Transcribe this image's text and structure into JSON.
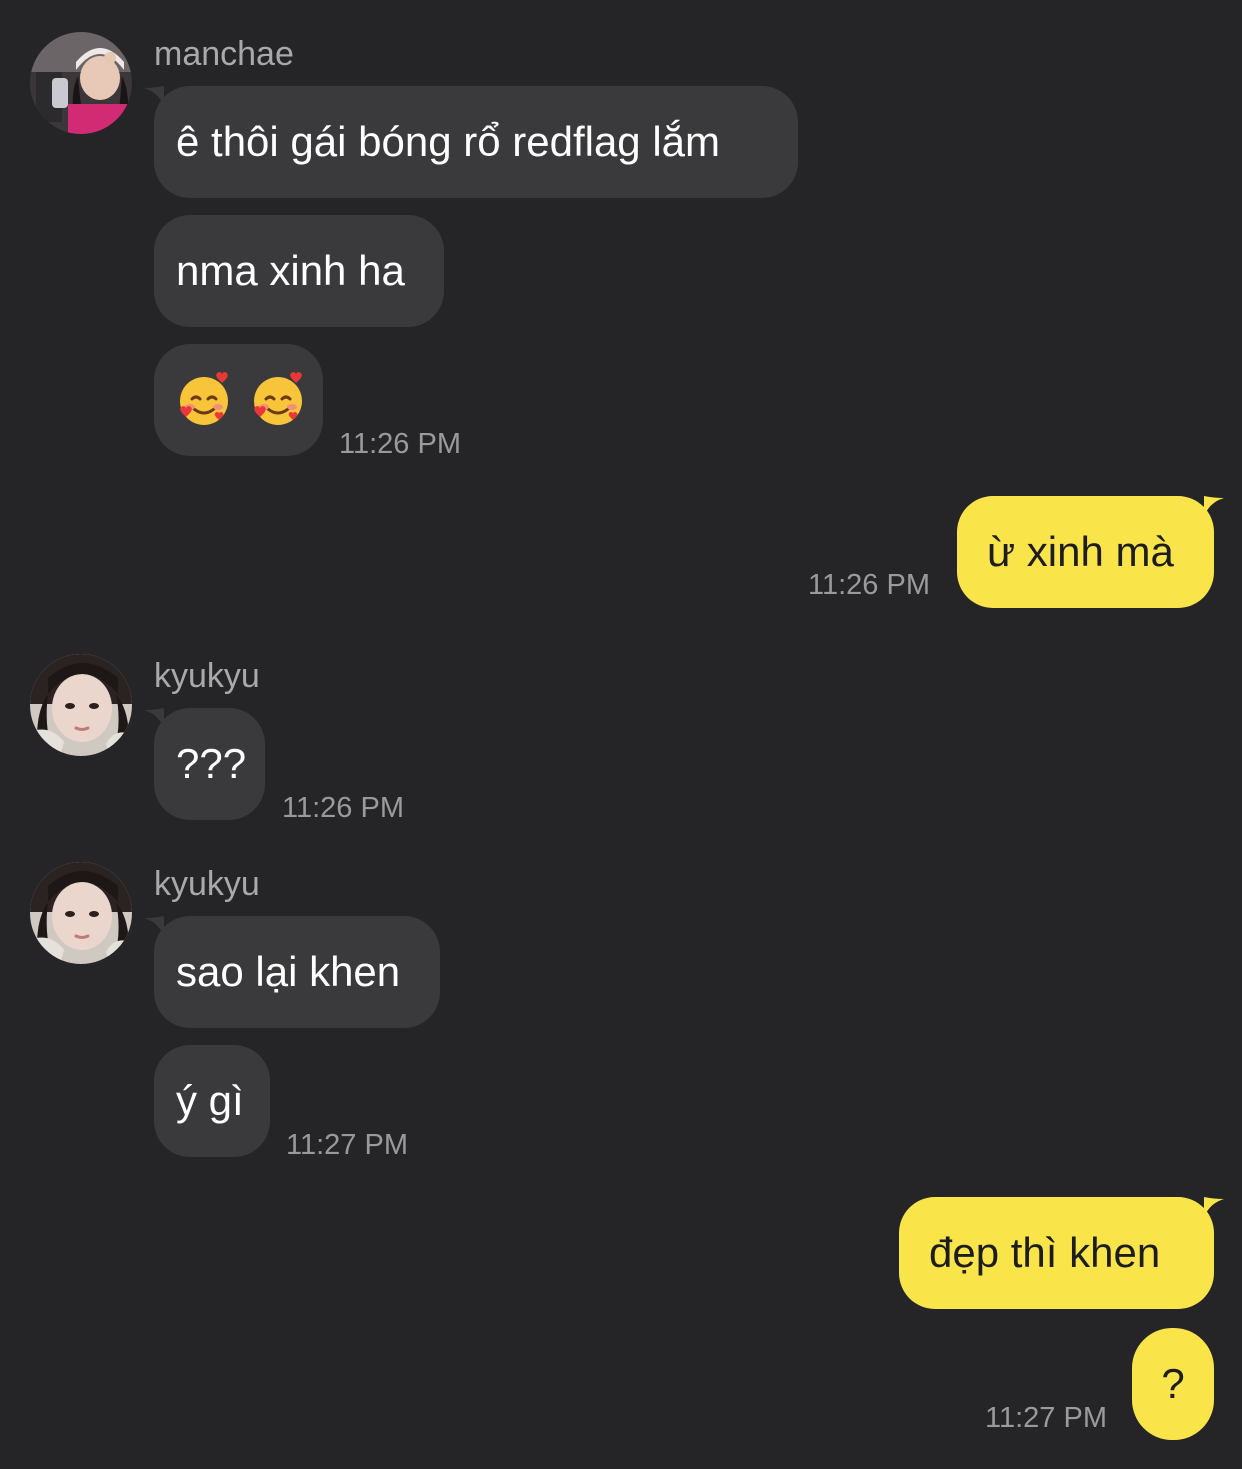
{
  "conversation": {
    "groups": [
      {
        "sender": "manchae",
        "avatar": "avatar-manchae",
        "messages": [
          "ê thôi gái bóng rổ redflag lắm",
          "nma xinh ha",
          "🥰 🥰"
        ],
        "time": "11:26 PM"
      },
      {
        "sender": "me",
        "messages": [
          "ừ xinh mà"
        ],
        "time": "11:26 PM"
      },
      {
        "sender": "kyukyu",
        "avatar": "avatar-kyukyu",
        "messages": [
          "???"
        ],
        "time": "11:26 PM"
      },
      {
        "sender": "kyukyu",
        "avatar": "avatar-kyukyu",
        "messages": [
          "sao lại khen",
          "ý gì"
        ],
        "time": "11:27 PM"
      },
      {
        "sender": "me",
        "messages": [
          "đẹp thì khen",
          "?"
        ],
        "time": "11:27 PM"
      }
    ]
  },
  "colors": {
    "background": "#252527",
    "incoming_bubble": "#3a3a3d",
    "outgoing_bubble": "#f9e54a",
    "sender_text": "#a9a9ad",
    "time_text": "#9a9a9e"
  }
}
